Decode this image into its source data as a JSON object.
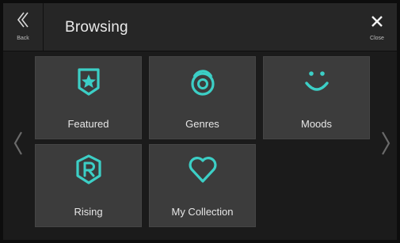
{
  "header": {
    "back_label": "Back",
    "title": "Browsing",
    "close_label": "Close"
  },
  "tiles": [
    {
      "label": "Featured",
      "icon": "badge-star-icon"
    },
    {
      "label": "Genres",
      "icon": "vinyl-record-icon"
    },
    {
      "label": "Moods",
      "icon": "smiley-face-icon"
    },
    {
      "label": "Rising",
      "icon": "rising-shield-icon"
    },
    {
      "label": "My Collection",
      "icon": "heart-icon"
    }
  ],
  "colors": {
    "accent": "#3ccfc6",
    "tile_bg": "#3c3c3c",
    "header_bg": "#262626"
  }
}
